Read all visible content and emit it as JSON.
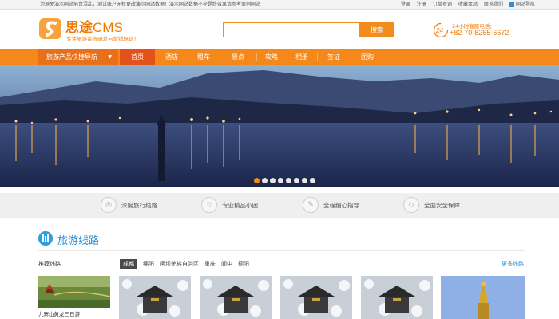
{
  "topbar": {
    "notice": "为避免演示网站前台混乱，测试账户无权更改演示网站数据！演示网站数据不全是终效果请参考案例网站",
    "links": [
      "登录",
      "注册",
      "订单查询",
      "收藏本站",
      "联系我们"
    ],
    "site_nav": "网站导航"
  },
  "header": {
    "brand_cn": "思途",
    "brand_en": "CMS",
    "tagline": "专注旅游系统研发与营销培训！",
    "search_button": "搜索",
    "search_placeholder": "",
    "hotline_badge": "24",
    "hotline_label": "24小时客服电话：",
    "hotline_number": "+82-70-8265-6672"
  },
  "nav": {
    "quick_label": "旅游产品快捷导航",
    "items": [
      "首页",
      "酒店",
      "租车",
      "景点",
      "攻略",
      "相册",
      "签证",
      "团购"
    ],
    "active_index": 0
  },
  "banner": {
    "slide_count": 8,
    "active_index": 0
  },
  "features": [
    "深度旅行线路",
    "专业精品小团",
    "全程细心指导",
    "全面安全保障"
  ],
  "routes": {
    "title": "旅游线路",
    "recommended_label": "推荐线路",
    "tabs": [
      "成都",
      "绵阳",
      "阿坝羌族自治区",
      "重庆",
      "阆中",
      "德阳"
    ],
    "active_tab": 0,
    "more": "更多线路",
    "rec_caption": "九寨山黄龙三日游"
  },
  "colors": {
    "accent": "#f4881a",
    "accent_dark": "#e2521a",
    "link": "#2a8fd6"
  }
}
